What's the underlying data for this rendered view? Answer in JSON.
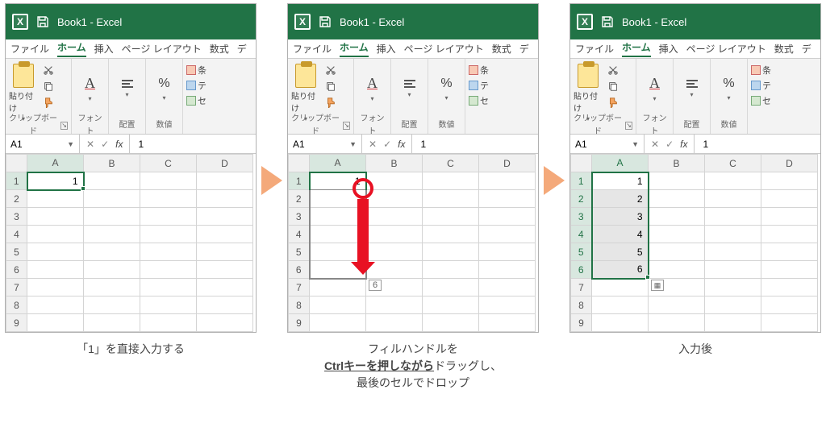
{
  "common": {
    "title": "Book1 - Excel",
    "logo_letter": "X",
    "tabs": {
      "file": "ファイル",
      "home": "ホーム",
      "insert": "挿入",
      "layout": "ページ レイアウト",
      "formulas": "数式",
      "data_trunc": "デ"
    },
    "ribbon": {
      "paste": "貼り付け",
      "clipboard": "クリップボード",
      "font": "フォント",
      "align": "配置",
      "number": "数値",
      "cond_trunc": "条",
      "table_trunc": "テ",
      "cell_trunc": "セ"
    },
    "fbar": {
      "x": "✕",
      "check": "✓",
      "fx": "fx"
    },
    "columns": [
      "A",
      "B",
      "C",
      "D"
    ],
    "rows": [
      "1",
      "2",
      "3",
      "4",
      "5",
      "6",
      "7",
      "8",
      "9"
    ]
  },
  "panel1": {
    "namebox": "A1",
    "formula": "1",
    "cell_a1": "1",
    "caption": "「1」を直接入力する"
  },
  "panel2": {
    "namebox": "A1",
    "formula": "1",
    "cell_a1": "1",
    "tooltip": "6",
    "caption_line1": "フィルハンドルを",
    "caption_bold": "Ctrlキーを押しながら",
    "caption_tail": "ドラッグし、",
    "caption_line3": "最後のセルでドロップ"
  },
  "panel3": {
    "namebox": "A1",
    "formula": "1",
    "values": [
      "1",
      "2",
      "3",
      "4",
      "5",
      "6"
    ],
    "caption": "入力後"
  }
}
